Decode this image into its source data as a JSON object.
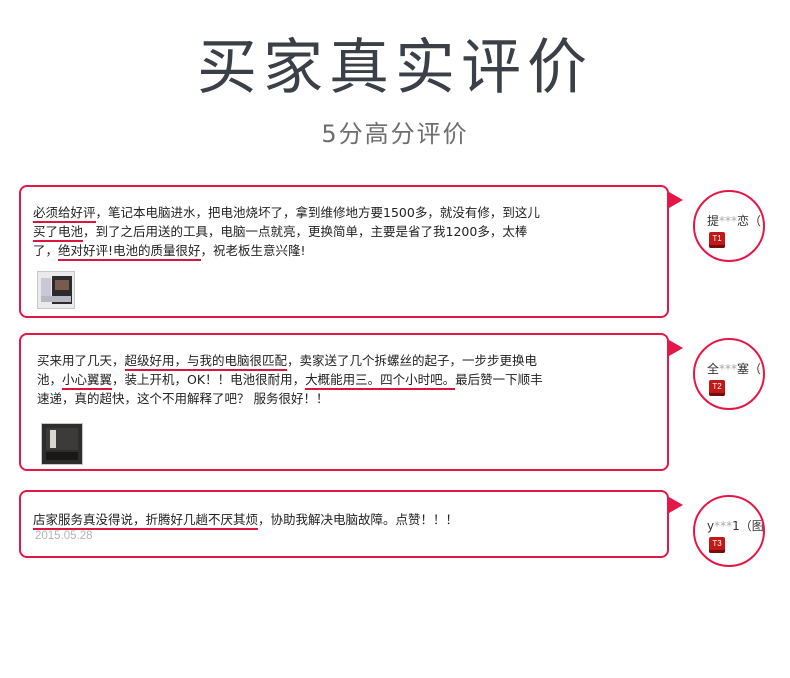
{
  "header": {
    "title": "买家真实评价",
    "subtitle": "5分高分评价"
  },
  "reviews": [
    {
      "segments": [
        {
          "t": "必须给好评",
          "u": true
        },
        {
          "t": "，笔记本电脑进水，把电池烧坏了，拿到维修地方要1500多，就没有修，到这儿",
          "u": false
        },
        {
          "t": "\n",
          "u": false
        },
        {
          "t": "买了电池",
          "u": true
        },
        {
          "t": "，到了之后用送的工具，电脑一点就亮，更换简单，主要是省了我1200多，太棒",
          "u": false
        },
        {
          "t": "\n",
          "u": false
        },
        {
          "t": "了，",
          "u": false
        },
        {
          "t": "绝对好评!电池的质量很好",
          "u": true
        },
        {
          "t": "，祝老板生意兴隆!",
          "u": false
        }
      ],
      "username": "提",
      "username_mask": "***",
      "username_tail": "恋（",
      "badge": "T1"
    },
    {
      "segments": [
        {
          "t": "买来用了几天，",
          "u": false
        },
        {
          "t": "超级好用，与我的电脑很匹配",
          "u": true
        },
        {
          "t": "，卖家送了几个拆螺丝的起子，一步步更换电",
          "u": false
        },
        {
          "t": "\n",
          "u": false
        },
        {
          "t": "池，",
          "u": false
        },
        {
          "t": "小心翼翼",
          "u": true
        },
        {
          "t": "，装上开机，OK！！电池很耐用，",
          "u": false
        },
        {
          "t": "大概能用三。四个小时吧。",
          "u": true
        },
        {
          "t": "最后赞一下顺丰",
          "u": false
        },
        {
          "t": "\n",
          "u": false
        },
        {
          "t": "速递，真的超快，这个不用解释了吧？ 服务很好！！",
          "u": false
        }
      ],
      "username": "全",
      "username_mask": "***",
      "username_tail": "塞（",
      "badge": "T2"
    },
    {
      "segments": [
        {
          "t": "店家服务真没得说，",
          "u": true
        },
        {
          "t": "折腾好几趟不厌其烦",
          "u": true
        },
        {
          "t": "，协助我解决电脑故障。点赞！！！",
          "u": false
        }
      ],
      "date": "2015.05.28",
      "username": "y",
      "username_mask": "***",
      "username_tail": "1（图",
      "badge": "T3"
    }
  ],
  "colors": {
    "accent": "#e51746",
    "title": "#3a3f48",
    "badge": "#c11818"
  }
}
